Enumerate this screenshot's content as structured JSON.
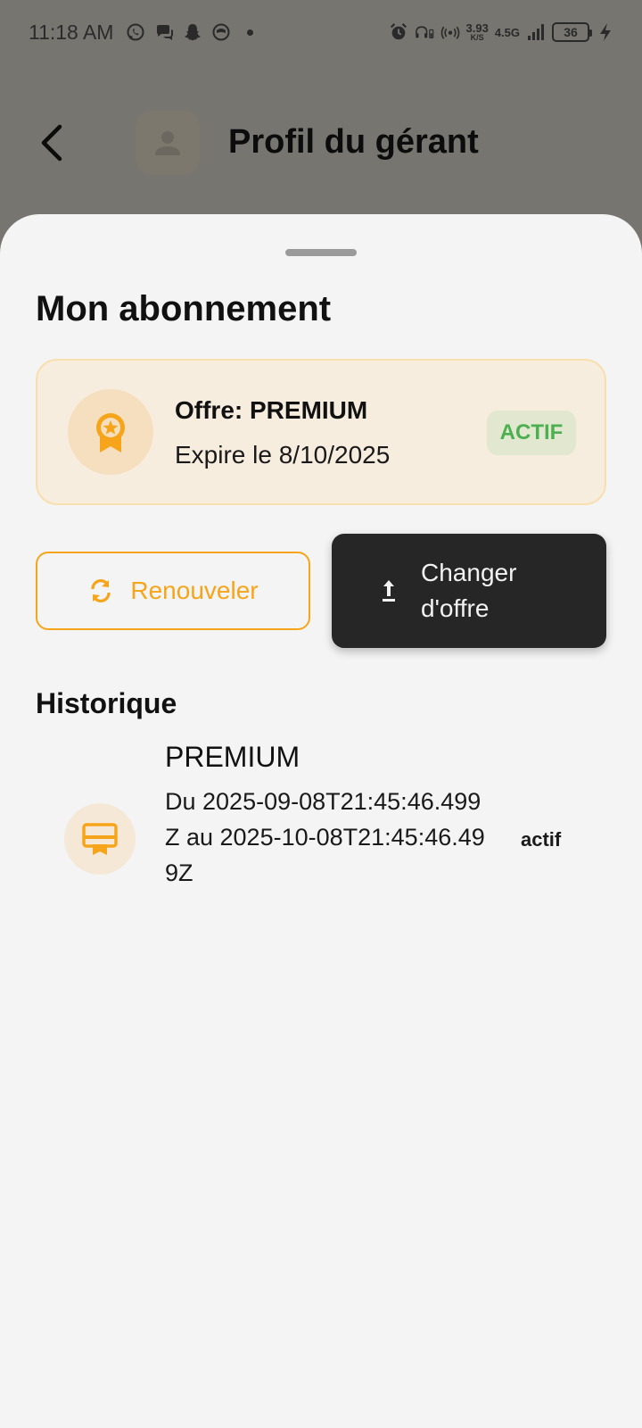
{
  "status_bar": {
    "time": "11:18 AM",
    "speed_value": "3.93",
    "speed_unit": "K/S",
    "network": "4.5G",
    "battery": "36",
    "icons": [
      "whatsapp-icon",
      "chat-icon",
      "snapchat-icon",
      "app-icon",
      "alarm-icon",
      "headphones-icon",
      "hotspot-icon",
      "signal-icon",
      "charging-icon"
    ]
  },
  "header": {
    "title": "Profil du gérant",
    "back_icon": "chevron-left-icon",
    "avatar_icon": "person-icon"
  },
  "sheet": {
    "title": "Mon abonnement",
    "subscription": {
      "offer": "Offre: PREMIUM",
      "expires": "Expire le 8/10/2025",
      "status": "ACTIF",
      "icon": "medal-icon"
    },
    "actions": {
      "renew_label": "Renouveler",
      "renew_icon": "refresh-icon",
      "change_label": "Changer d'offre",
      "change_icon": "upload-icon"
    },
    "history": {
      "title": "Historique",
      "items": [
        {
          "plan": "PREMIUM",
          "period": "Du 2025-09-08T21:45:46.499Z au 2025-10-08T21:45:46.499Z",
          "status": "actif",
          "icon": "card-membership-icon"
        }
      ]
    }
  },
  "colors": {
    "accent": "#f6a51a",
    "active_green": "#4caf50",
    "dark_button": "#262626",
    "sheet_bg": "#f4f4f4",
    "scrim": "#777570"
  }
}
